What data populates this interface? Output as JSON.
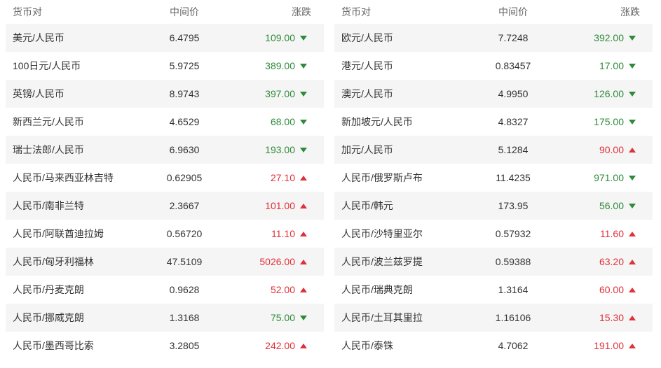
{
  "headers": {
    "pair": "货币对",
    "mid": "中间价",
    "change": "涨跌"
  },
  "colors": {
    "up": "#e0303a",
    "down": "#2e8b3a"
  },
  "left": [
    {
      "pair": "美元/人民币",
      "mid": "6.4795",
      "change": "109.00",
      "dir": "down"
    },
    {
      "pair": "100日元/人民币",
      "mid": "5.9725",
      "change": "389.00",
      "dir": "down"
    },
    {
      "pair": "英镑/人民币",
      "mid": "8.9743",
      "change": "397.00",
      "dir": "down"
    },
    {
      "pair": "新西兰元/人民币",
      "mid": "4.6529",
      "change": "68.00",
      "dir": "down"
    },
    {
      "pair": "瑞士法郎/人民币",
      "mid": "6.9630",
      "change": "193.00",
      "dir": "down"
    },
    {
      "pair": "人民币/马来西亚林吉特",
      "mid": "0.62905",
      "change": "27.10",
      "dir": "up"
    },
    {
      "pair": "人民币/南非兰特",
      "mid": "2.3667",
      "change": "101.00",
      "dir": "up"
    },
    {
      "pair": "人民币/阿联酋迪拉姆",
      "mid": "0.56720",
      "change": "11.10",
      "dir": "up"
    },
    {
      "pair": "人民币/匈牙利福林",
      "mid": "47.5109",
      "change": "5026.00",
      "dir": "up"
    },
    {
      "pair": "人民币/丹麦克朗",
      "mid": "0.9628",
      "change": "52.00",
      "dir": "up"
    },
    {
      "pair": "人民币/挪威克朗",
      "mid": "1.3168",
      "change": "75.00",
      "dir": "down"
    },
    {
      "pair": "人民币/墨西哥比索",
      "mid": "3.2805",
      "change": "242.00",
      "dir": "up"
    }
  ],
  "right": [
    {
      "pair": "欧元/人民币",
      "mid": "7.7248",
      "change": "392.00",
      "dir": "down"
    },
    {
      "pair": "港元/人民币",
      "mid": "0.83457",
      "change": "17.00",
      "dir": "down"
    },
    {
      "pair": "澳元/人民币",
      "mid": "4.9950",
      "change": "126.00",
      "dir": "down"
    },
    {
      "pair": "新加坡元/人民币",
      "mid": "4.8327",
      "change": "175.00",
      "dir": "down"
    },
    {
      "pair": "加元/人民币",
      "mid": "5.1284",
      "change": "90.00",
      "dir": "up"
    },
    {
      "pair": "人民币/俄罗斯卢布",
      "mid": "11.4235",
      "change": "971.00",
      "dir": "down"
    },
    {
      "pair": "人民币/韩元",
      "mid": "173.95",
      "change": "56.00",
      "dir": "down"
    },
    {
      "pair": "人民币/沙特里亚尔",
      "mid": "0.57932",
      "change": "11.60",
      "dir": "up"
    },
    {
      "pair": "人民币/波兰兹罗提",
      "mid": "0.59388",
      "change": "63.20",
      "dir": "up"
    },
    {
      "pair": "人民币/瑞典克朗",
      "mid": "1.3164",
      "change": "60.00",
      "dir": "up"
    },
    {
      "pair": "人民币/土耳其里拉",
      "mid": "1.16106",
      "change": "15.30",
      "dir": "up"
    },
    {
      "pair": "人民币/泰铢",
      "mid": "4.7062",
      "change": "191.00",
      "dir": "up"
    }
  ]
}
